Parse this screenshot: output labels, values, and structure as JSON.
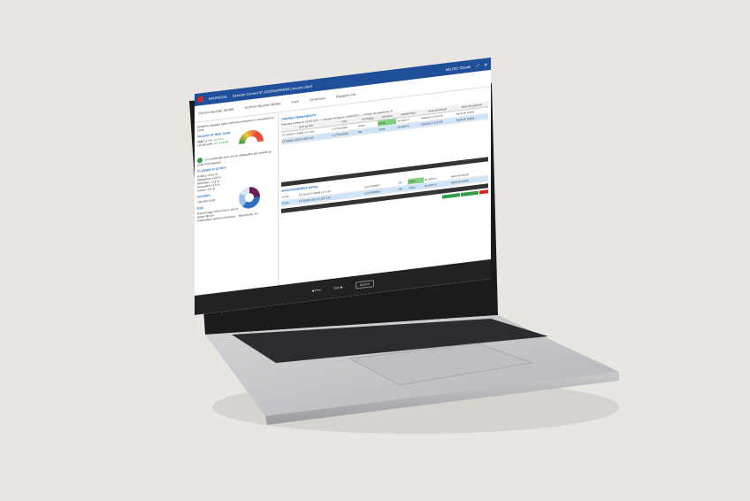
{
  "app": {
    "brand": "SPURIEDG",
    "session_title": "Session Conseil N° 2023032490004 | Accord client",
    "user": "MILTEC Claude"
  },
  "subheader": {
    "client_label": "Nom",
    "client_name": "OCHOA HELENE DEDBA",
    "contract_label": "Numéro contrat",
    "contract_value": "OCHOA HELENE DEDBA",
    "regime_label": "Fiscalité",
    "regime_value": "Impôt",
    "profile_label": "Profil conseil",
    "profile_value": "Dynamique",
    "mandate_label": "Indicateur de l'adéquation",
    "mandate_value": "Dégagées info"
  },
  "left_panel": {
    "summary": "Synthèse situation après permute entreprise et conseillement CGM",
    "risk_title": "VALEUR AT RISK (VaR)",
    "var_label": "VaR",
    "var_value": "5.17 %",
    "var_change": "+9.29 %",
    "var_amount": "14/136 EUR",
    "var_amount_change": "+4 / 44 EUR",
    "gauge_labels": [
      "7.30 %",
      "13.68 %"
    ],
    "adequation_text": "Le portefeuille mine est en adéquation par rapport au profil d'investisseur",
    "classes_title": "CLASSES D'ACTIFS",
    "classes": [
      {
        "name": "Actions",
        "value": "+20.5 %",
        "amount": "8.865 TEUR"
      },
      {
        "name": "Obligations",
        "value": "+0.8 %",
        "amount": "4.59 EUR"
      },
      {
        "name": "Monétaire",
        "value": "+2.1 %",
        "amount": "1.06 EUR"
      },
      {
        "name": "Diversifiés",
        "value": "+3.0 %",
        "amount": "1.03 EUR"
      },
      {
        "name": "Autres",
        "value": "+4.5 %",
        "amount": "1.65 EUR"
      }
    ],
    "devises_title": "DEVISES",
    "devises_value": "100.00%",
    "devises_currency": "EUR",
    "esg_title": "ESG",
    "esg_rows": [
      {
        "label": "Pourcentage ESG",
        "a": "0.00 %",
        "b": "100 %"
      },
      {
        "label": "Notes",
        "a": "NR",
        "b": "AA"
      },
      {
        "label": "Thématique préférée",
        "a": "Environn...",
        "b": "Biodiversité, éc..."
      }
    ]
  },
  "right_panel": {
    "orders_title": "ORDRES PERMANENTS",
    "orders_date_label": "Première échéance",
    "orders_date": "01/05/2023",
    "orders_end_label": "Dernière échéance",
    "orders_end": "01/05/2025",
    "orders_count_label": "Nombre de paiements",
    "orders_count": "24",
    "columns": [
      "Nom du Titre",
      "ISIN",
      "CDI Rating",
      "Opération",
      "Montant Brut",
      "% du portefeuille",
      "Mode de paiement"
    ],
    "orders_rows": [
      [
        "EIT RISQTY GNRB L.P. CAP",
        "LU2719169D7",
        "10ans",
        "Achat",
        "49 290€ %",
        "2092209 1 CHFTTE",
        "Agent de Impôts"
      ],
      [
        "EIT BOND 20EUS LDR CAP",
        "LU2719169D9",
        "NR",
        "Achat",
        "49 290€ %",
        "2092209 1 CHFTTE",
        "Agent de Impôts"
      ]
    ],
    "invest_title": "INVESTISSEMENT INITIAL",
    "invest_rows": [
      [
        "ECRA",
        "EIT RISQTY GNRB L.P. CAP",
        "LU2719169D7",
        "NR",
        "Achat",
        "49 290€ %",
        "Agent de Impôts"
      ],
      [
        "ECRA",
        "EIT BOND 20EUS LDR CAP",
        "LU2719169D9",
        "NR",
        "Achat",
        "49 290€ %",
        "Agent de Impôts"
      ]
    ]
  },
  "bottom_bar": {
    "prev_label": "Prec",
    "next_label": "Suiv",
    "accept_label": "Accord"
  }
}
